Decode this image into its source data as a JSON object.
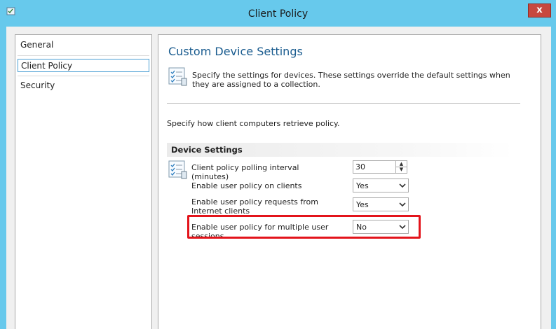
{
  "window": {
    "title": "Client Policy",
    "close_label": "x"
  },
  "nav": {
    "items": [
      {
        "label": "General"
      },
      {
        "label": "Client Policy"
      },
      {
        "label": "Security"
      }
    ],
    "selected": "Client Policy"
  },
  "main": {
    "heading": "Custom Device Settings",
    "description": "Specify the settings for devices. These settings override the default settings when they are assigned to a collection.",
    "intro": "Specify how client computers retrieve policy.",
    "section_title": "Device Settings",
    "settings": [
      {
        "label": "Client policy polling interval (minutes)",
        "value": "30"
      },
      {
        "label": "Enable user policy on clients",
        "value": "Yes"
      },
      {
        "label": "Enable user policy requests from Internet clients",
        "value": "Yes"
      },
      {
        "label": "Enable user policy for multiple user sessions",
        "value": "No"
      }
    ]
  },
  "colors": {
    "titlebar": "#67c9ec",
    "close_button": "#c7483f",
    "heading": "#1a5c8f",
    "highlight": "#e3141b",
    "selection_border": "#4a9fd4"
  }
}
